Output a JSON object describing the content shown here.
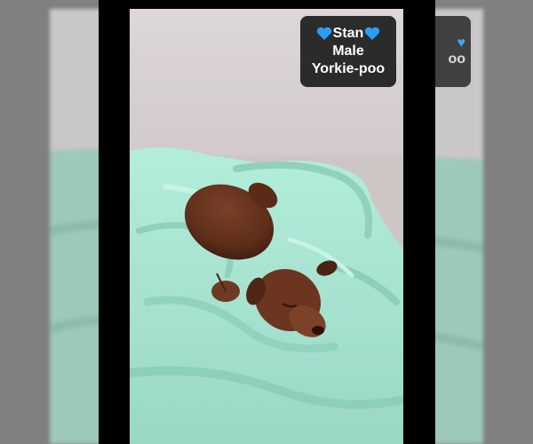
{
  "label": {
    "name": "Stan",
    "sex": "Male",
    "breed": "Yorkie-poo",
    "heart_color": "#2a9df4",
    "blurred_right_fragment": "oo"
  },
  "colors": {
    "wall": "#d9d4d6",
    "floor": "#cfc8c6",
    "blanket": "#a8e8d4",
    "blanket_shadow": "#7fc9b3",
    "puppy": "#6a3520",
    "puppy_dark": "#3f1d10",
    "frame": "#000000",
    "letterbox_gray": "#808080",
    "label_bg": "#2b2b2b"
  }
}
